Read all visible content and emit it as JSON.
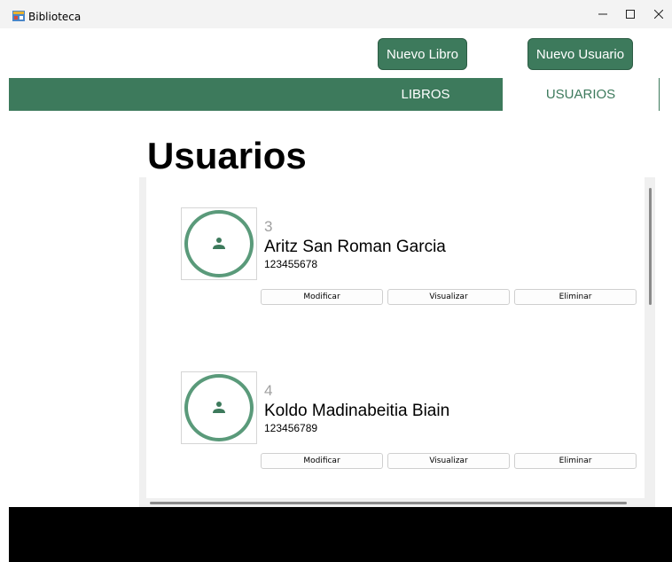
{
  "window": {
    "title": "Biblioteca"
  },
  "toolbar": {
    "nuevo_libro": "Nuevo Libro",
    "nuevo_usuario": "Nuevo Usuario"
  },
  "nav": {
    "tabs": [
      {
        "label": "LIBROS"
      },
      {
        "label": "USUARIOS"
      }
    ],
    "active_tab": "USUARIOS"
  },
  "page": {
    "title": "Usuarios"
  },
  "users": [
    {
      "id": "3",
      "name": "Aritz San Roman Garcia",
      "phone": "123455678",
      "actions": {
        "modify": "Modificar",
        "view": "Visualizar",
        "delete": "Eliminar"
      }
    },
    {
      "id": "4",
      "name": "Koldo Madinabeitia Biain",
      "phone": "123456789",
      "actions": {
        "modify": "Modificar",
        "view": "Visualizar",
        "delete": "Eliminar"
      }
    }
  ],
  "colors": {
    "accent": "#3d7a5c",
    "avatar_ring": "#5a9a7a"
  }
}
